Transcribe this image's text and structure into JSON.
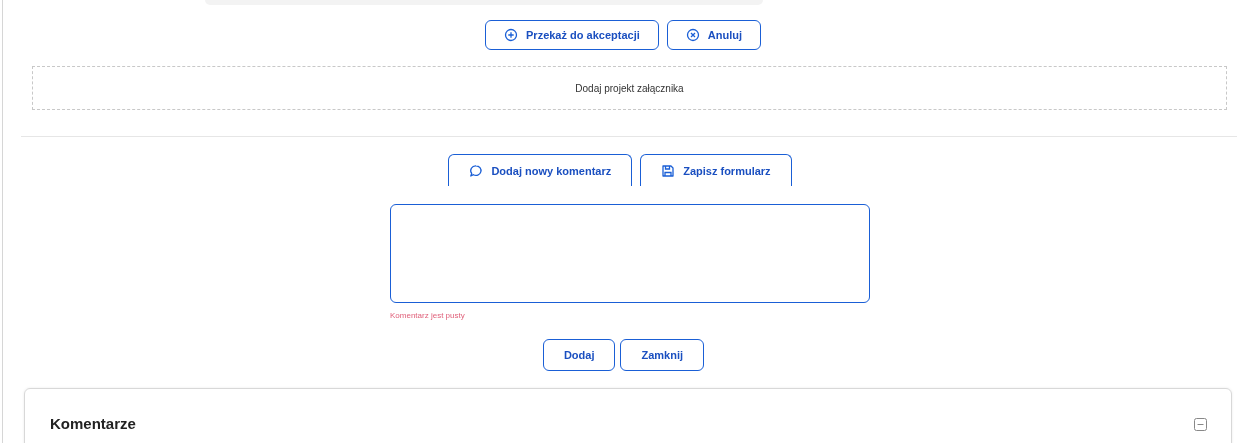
{
  "top_actions": [
    {
      "label": "Przekaż do akceptacji",
      "kind": "plus"
    },
    {
      "label": "Anuluj",
      "kind": "cancel"
    }
  ],
  "attachment_dropzone": {
    "label": "Dodaj projekt załącznika"
  },
  "comment_actions": [
    {
      "label": "Dodaj nowy komentarz",
      "kind": "comment"
    },
    {
      "label": "Zapisz formularz",
      "kind": "save"
    }
  ],
  "comment_field": {
    "error": "Komentarz jest pusty"
  },
  "comment_buttons": [
    "Dodaj",
    "Zamknij"
  ],
  "comments_panel": {
    "title": "Komentarze",
    "expanded": true
  }
}
